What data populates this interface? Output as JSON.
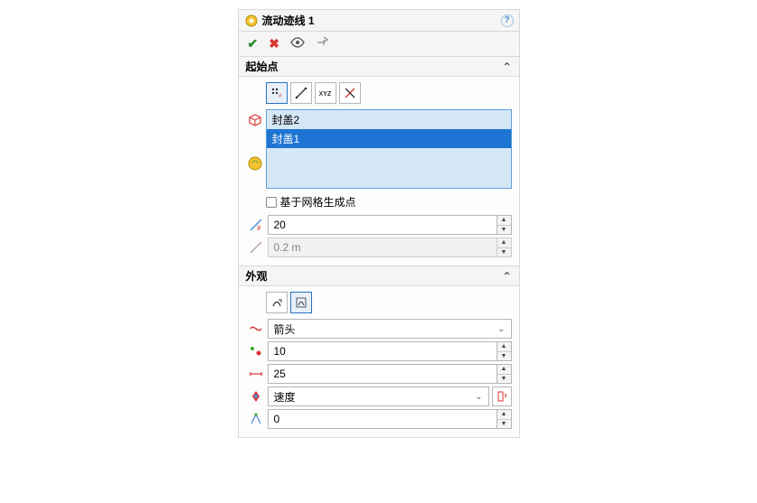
{
  "title": "流动迹线 1",
  "section_start": {
    "header": "起始点",
    "toolbar_hint": {
      "xyz": "xʏz"
    },
    "list_items": [
      "封盖2",
      "封盖1"
    ],
    "selected_index": 1,
    "checkbox_label": "基于网格生成点",
    "checked": false,
    "count_value": "20",
    "spacing_value": "0.2 m",
    "spacing_enabled": false
  },
  "section_appearance": {
    "header": "外观",
    "style_select": "箭头",
    "density_value": "10",
    "width_value": "25",
    "color_by_select": "速度",
    "gradient_value": "0"
  }
}
